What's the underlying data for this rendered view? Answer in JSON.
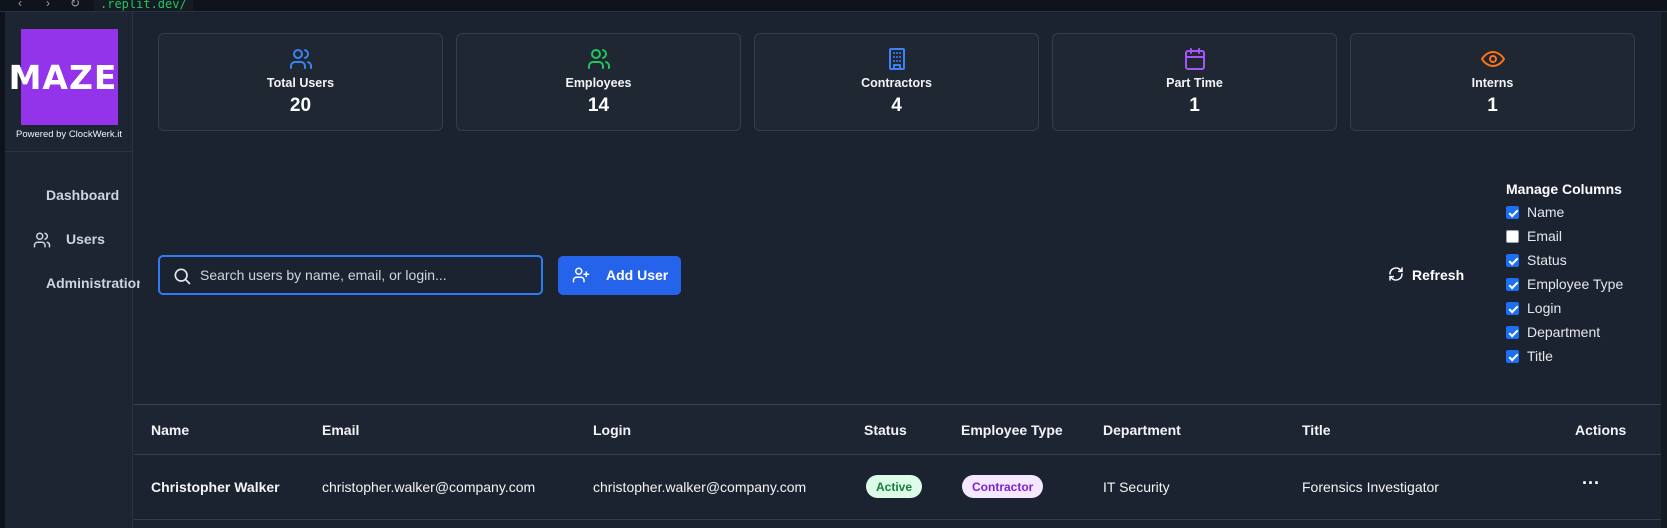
{
  "browser": {
    "url": ".replit.dev/"
  },
  "logo": {
    "text": "MAZE",
    "powered_by": "Powered by ClockWerk.it",
    "color": "#9333ea"
  },
  "sidebar": {
    "items": [
      {
        "label": "Dashboard",
        "icon": "none"
      },
      {
        "label": "Users",
        "icon": "users-icon"
      },
      {
        "label": "Administration",
        "icon": "none"
      }
    ]
  },
  "stats": [
    {
      "label": "Total Users",
      "value": "20",
      "icon": "users-icon",
      "color": "#3b82f6"
    },
    {
      "label": "Employees",
      "value": "14",
      "icon": "users-icon",
      "color": "#22c55e"
    },
    {
      "label": "Contractors",
      "value": "4",
      "icon": "building-icon",
      "color": "#3b82f6"
    },
    {
      "label": "Part Time",
      "value": "1",
      "icon": "calendar-icon",
      "color": "#a855f7"
    },
    {
      "label": "Interns",
      "value": "1",
      "icon": "eye-icon",
      "color": "#f97316"
    }
  ],
  "toolbar": {
    "search_placeholder": "Search users by name, email, or login...",
    "add_user_label": "Add User",
    "refresh_label": "Refresh"
  },
  "manage_columns": {
    "title": "Manage Columns",
    "options": [
      {
        "name": "Name",
        "checked": true
      },
      {
        "name": "Email",
        "checked": false
      },
      {
        "name": "Status",
        "checked": true
      },
      {
        "name": "Employee Type",
        "checked": true
      },
      {
        "name": "Login",
        "checked": true
      },
      {
        "name": "Department",
        "checked": true
      },
      {
        "name": "Title",
        "checked": true
      }
    ]
  },
  "table": {
    "headers": [
      "Name",
      "Email",
      "Login",
      "Status",
      "Employee Type",
      "Department",
      "Title",
      "Actions"
    ],
    "rows": [
      {
        "name": "Christopher Walker",
        "email": "christopher.walker@company.com",
        "login": "christopher.walker@company.com",
        "status": "Active",
        "employee_type": "Contractor",
        "department": "IT Security",
        "title": "Forensics Investigator",
        "actions": "···"
      }
    ]
  }
}
